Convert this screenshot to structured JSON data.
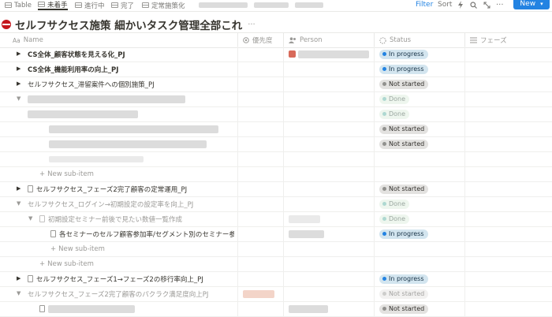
{
  "tabs": [
    {
      "label": "Table"
    },
    {
      "label": "未着手"
    },
    {
      "label": "進行中"
    },
    {
      "label": "完了"
    },
    {
      "label": "定常施策化"
    }
  ],
  "toolbar": {
    "filter": "Filter",
    "sort": "Sort",
    "new_label": "New"
  },
  "title": "セルフサクセス施策 細かいタスク管理全部これ",
  "title_more": "···",
  "columns": {
    "name": "Name",
    "priority": "優先度",
    "person": "Person",
    "status": "Status",
    "phase": "フェーズ"
  },
  "rows": [
    {
      "name": "CS全体_顧客状態を見える化_PJ",
      "status": "In progress"
    },
    {
      "name": "CS全体_機能利用率の向上_PJ",
      "status": "In progress"
    },
    {
      "name": "セルフサクセス_滞留案件への個別施策_PJ",
      "status": "Not started"
    },
    {
      "name": "",
      "status": "Done"
    },
    {
      "name": "",
      "status": "Done"
    },
    {
      "name": "",
      "status": "Not started"
    },
    {
      "name": "",
      "status": "Not started"
    },
    {
      "name": "",
      "status": ""
    },
    {
      "name": "New sub-item",
      "status": ""
    },
    {
      "name": "セルフサクセス_フェーズ2完了顧客の定常運用_PJ",
      "status": "Not started"
    },
    {
      "name": "セルフサクセス_ログイン→初期設定の設定率を向上_PJ",
      "status": "Done"
    },
    {
      "name": "初期設定セミナー前後で見たい数値一覧作成",
      "status": "Done"
    },
    {
      "name": "各セミナーのセルフ顧客参加率/セグメント別のセミナー参加率",
      "status": "In progress"
    },
    {
      "name": "New sub-item",
      "status": ""
    },
    {
      "name": "New sub-item",
      "status": ""
    },
    {
      "name": "セルフサクセス_フェーズ1→フェーズ2の移行率向上_PJ",
      "status": "In progress"
    },
    {
      "name": "セルフサクセス_フェーズ2完了顧客のパクラク満足度向上PJ",
      "status": "Not started"
    },
    {
      "name": "",
      "status": "Not started"
    }
  ]
}
